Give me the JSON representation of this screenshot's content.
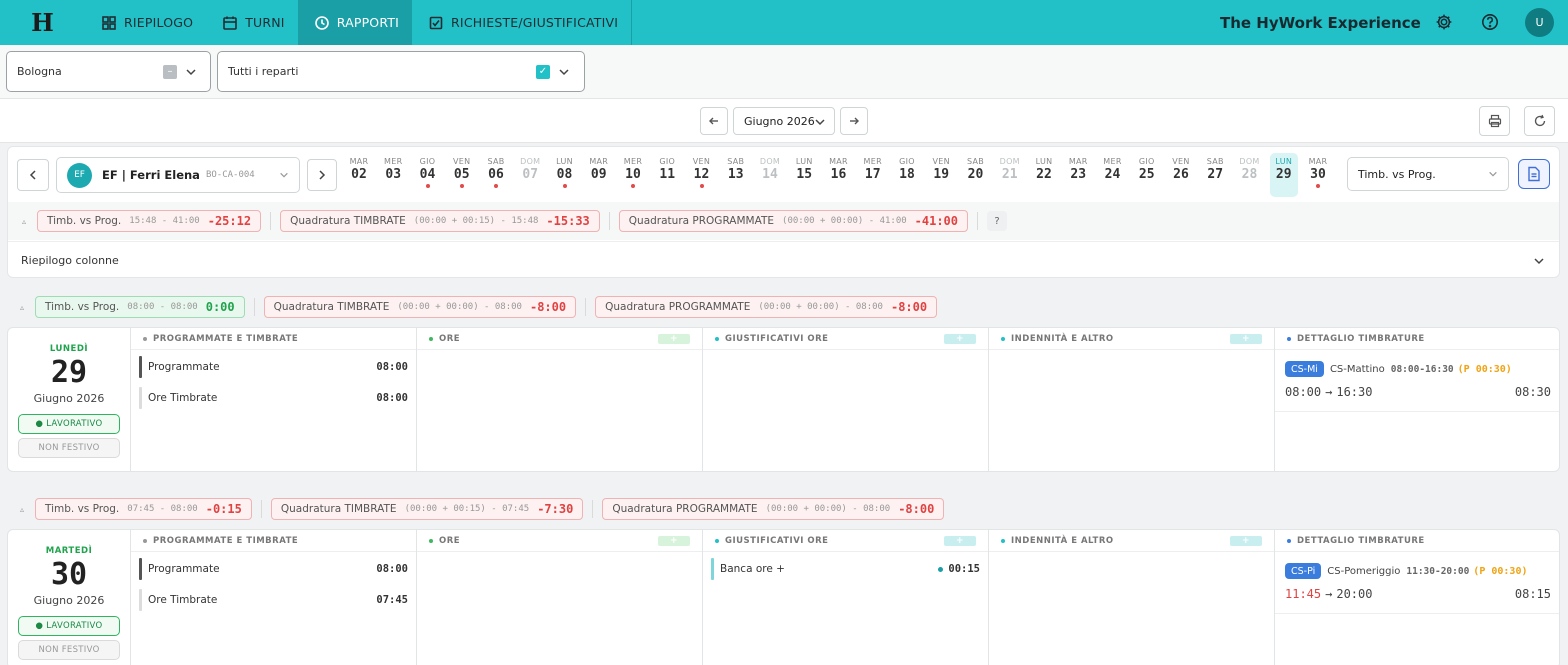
{
  "nav": {
    "logo": "H",
    "tabs": [
      {
        "label": "RIEPILOGO",
        "icon": "grid-icon"
      },
      {
        "label": "TURNI",
        "icon": "calendar-icon"
      },
      {
        "label": "RAPPORTI",
        "icon": "clock-icon"
      },
      {
        "label": "RICHIESTE/GIUSTIFICATIVI",
        "icon": "checklist-icon"
      }
    ],
    "active_tab": "RAPPORTI",
    "brand": "The HyWork Experience",
    "avatar": "U"
  },
  "filters": {
    "location": "Bologna",
    "departments": "Tutti i reparti"
  },
  "month_selector": {
    "label": "Giugno 2026"
  },
  "employee": {
    "initials": "EF",
    "name": "EF | Ferri Elena",
    "code": "BO-CA-004"
  },
  "calendar": {
    "days": [
      {
        "dn": "MAR",
        "dd": "02",
        "dot": false,
        "weekend": false
      },
      {
        "dn": "MER",
        "dd": "03",
        "dot": false,
        "weekend": false
      },
      {
        "dn": "GIO",
        "dd": "04",
        "dot": true,
        "weekend": false
      },
      {
        "dn": "VEN",
        "dd": "05",
        "dot": true,
        "weekend": false
      },
      {
        "dn": "SAB",
        "dd": "06",
        "dot": true,
        "weekend": false
      },
      {
        "dn": "DOM",
        "dd": "07",
        "dot": false,
        "weekend": true
      },
      {
        "dn": "LUN",
        "dd": "08",
        "dot": true,
        "weekend": false
      },
      {
        "dn": "MAR",
        "dd": "09",
        "dot": false,
        "weekend": false
      },
      {
        "dn": "MER",
        "dd": "10",
        "dot": true,
        "weekend": false
      },
      {
        "dn": "GIO",
        "dd": "11",
        "dot": false,
        "weekend": false
      },
      {
        "dn": "VEN",
        "dd": "12",
        "dot": true,
        "weekend": false
      },
      {
        "dn": "SAB",
        "dd": "13",
        "dot": false,
        "weekend": false
      },
      {
        "dn": "DOM",
        "dd": "14",
        "dot": false,
        "weekend": true
      },
      {
        "dn": "LUN",
        "dd": "15",
        "dot": false,
        "weekend": false
      },
      {
        "dn": "MAR",
        "dd": "16",
        "dot": false,
        "weekend": false
      },
      {
        "dn": "MER",
        "dd": "17",
        "dot": false,
        "weekend": false
      },
      {
        "dn": "GIO",
        "dd": "18",
        "dot": false,
        "weekend": false
      },
      {
        "dn": "VEN",
        "dd": "19",
        "dot": false,
        "weekend": false
      },
      {
        "dn": "SAB",
        "dd": "20",
        "dot": false,
        "weekend": false
      },
      {
        "dn": "DOM",
        "dd": "21",
        "dot": false,
        "weekend": true
      },
      {
        "dn": "LUN",
        "dd": "22",
        "dot": false,
        "weekend": false
      },
      {
        "dn": "MAR",
        "dd": "23",
        "dot": false,
        "weekend": false
      },
      {
        "dn": "MER",
        "dd": "24",
        "dot": false,
        "weekend": false
      },
      {
        "dn": "GIO",
        "dd": "25",
        "dot": false,
        "weekend": false
      },
      {
        "dn": "VEN",
        "dd": "26",
        "dot": false,
        "weekend": false
      },
      {
        "dn": "SAB",
        "dd": "27",
        "dot": false,
        "weekend": false
      },
      {
        "dn": "DOM",
        "dd": "28",
        "dot": false,
        "weekend": true
      },
      {
        "dn": "LUN",
        "dd": "29",
        "dot": false,
        "weekend": false,
        "selected": true
      },
      {
        "dn": "MAR",
        "dd": "30",
        "dot": true,
        "weekend": false
      }
    ]
  },
  "mode": "Timb. vs Prog.",
  "total_summary": {
    "p1": {
      "label": "Timb. vs Prog.",
      "sub": "15:48 - 41:00",
      "val": "-25:12"
    },
    "p2": {
      "label": "Quadratura TIMBRATE",
      "sub": "(00:00 + 00:15) - 15:48",
      "val": "-15:33"
    },
    "p3": {
      "label": "Quadratura PROGRAMMATE",
      "sub": "(00:00 + 00:00) - 41:00",
      "val": "-41:00"
    },
    "help": "?"
  },
  "riepilogo_label": "Riepilogo colonne",
  "columns": {
    "c1": "PROGRAMMATE E TIMBRATE",
    "c2": "ORE",
    "c3": "GIUSTIFICATIVI ORE",
    "c4": "INDENNITÀ E ALTRO",
    "c5": "DETTAGLIO TIMBRATURE"
  },
  "day29": {
    "summary": {
      "p1": {
        "label": "Timb. vs Prog.",
        "sub": "08:00 - 08:00",
        "val": "0:00"
      },
      "p2": {
        "label": "Quadratura TIMBRATE",
        "sub": "(00:00 + 00:00) - 08:00",
        "val": "-8:00"
      },
      "p3": {
        "label": "Quadratura PROGRAMMATE",
        "sub": "(00:00 + 00:00) - 08:00",
        "val": "-8:00"
      }
    },
    "weekday": "LUNEDÌ",
    "num": "29",
    "month": "Giugno 2026",
    "tag1": "LAVORATIVO",
    "tag2": "NON FESTIVO",
    "programmate_label": "Programmate",
    "programmate_val": "08:00",
    "timbrate_label": "Ore Timbrate",
    "timbrate_val": "08:00",
    "shift": {
      "badge": "CS-Mi",
      "name": "CS-Mattino",
      "hours": "08:00-16:30",
      "pause": "(P 00:30)"
    },
    "stamp": {
      "in": "08:00",
      "arrow": "→",
      "out": "16:30",
      "total": "08:30"
    }
  },
  "day30": {
    "summary": {
      "p1": {
        "label": "Timb. vs Prog.",
        "sub": "07:45 - 08:00",
        "val": "-0:15"
      },
      "p2": {
        "label": "Quadratura TIMBRATE",
        "sub": "(00:00 + 00:15) - 07:45",
        "val": "-7:30"
      },
      "p3": {
        "label": "Quadratura PROGRAMMATE",
        "sub": "(00:00 + 00:00) - 08:00",
        "val": "-8:00"
      }
    },
    "weekday": "MARTEDÌ",
    "num": "30",
    "month": "Giugno 2026",
    "tag1": "LAVORATIVO",
    "tag2": "NON FESTIVO",
    "programmate_label": "Programmate",
    "programmate_val": "08:00",
    "timbrate_label": "Ore Timbrate",
    "timbrate_val": "07:45",
    "giust_label": "Banca ore +",
    "giust_val": "00:15",
    "shift": {
      "badge": "CS-Pi",
      "name": "CS-Pomeriggio",
      "hours": "11:30-20:00",
      "pause": "(P 00:30)"
    },
    "stamp": {
      "in": "11:45",
      "arrow": "→",
      "out": "20:00",
      "total": "08:15"
    }
  },
  "colors": {
    "topbar": "#22c1c7",
    "active_tab": "#1a9fa6",
    "negative": "#e04242",
    "positive": "#1fa34c",
    "shift_badge": "#3b7ddd",
    "pause": "#f0a313"
  }
}
